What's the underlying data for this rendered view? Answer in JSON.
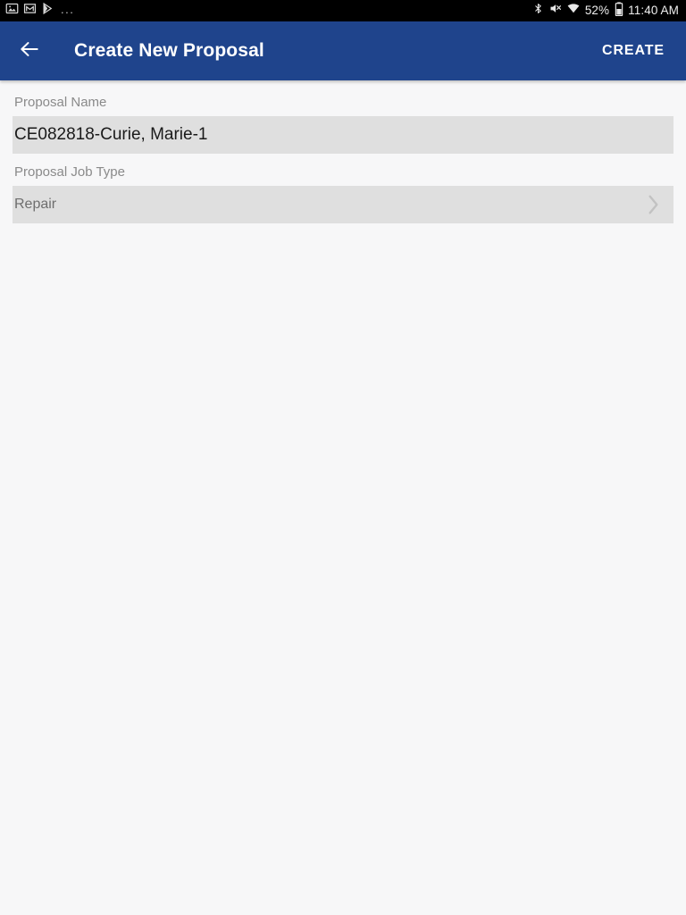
{
  "status_bar": {
    "left_icons": [
      "image-icon",
      "gmail-icon",
      "play-store-icon"
    ],
    "overflow_dots": "...",
    "right_icons": [
      "bluetooth-icon",
      "volume-muted-icon",
      "wifi-icon",
      "battery-icon"
    ],
    "battery_percent": "52%",
    "clock": "11:40 AM"
  },
  "app_bar": {
    "back_icon": "arrow-back-icon",
    "title": "Create New Proposal",
    "action_label": "CREATE",
    "background_color": "#1f448c"
  },
  "form": {
    "fields": [
      {
        "label": "Proposal Name",
        "value": "CE082818-Curie, Marie-1",
        "type": "text",
        "has_chevron": false
      },
      {
        "label": "Proposal Job Type",
        "value": "Repair",
        "type": "picker",
        "has_chevron": true,
        "chevron_icon": "chevron-right-icon"
      }
    ],
    "field_background_color": "#dfdfdf",
    "page_background_color": "#f7f7f8"
  }
}
